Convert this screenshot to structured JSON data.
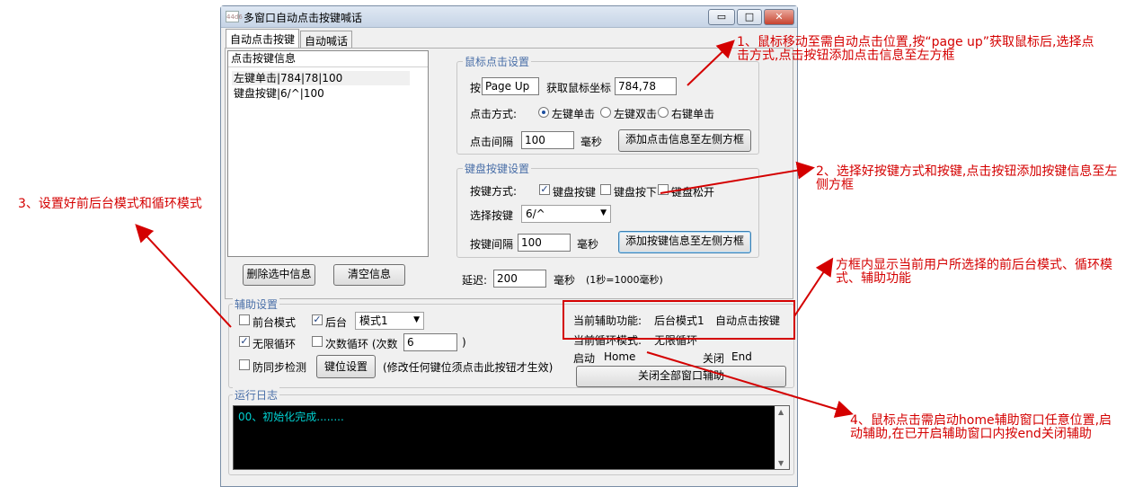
{
  "window": {
    "title": "多窗口自动点击按键喊话",
    "icon_text": "44d6",
    "controls": {
      "minimize": "▭",
      "maximize": "□",
      "close": "✕"
    }
  },
  "tabs": [
    {
      "label": "自动点击按键",
      "active": true
    },
    {
      "label": "自动喊话",
      "active": false
    }
  ],
  "key_list": {
    "header": "点击按键信息",
    "items": [
      "左键单击|784|78|100",
      "键盘按键|6/^|100"
    ]
  },
  "buttons": {
    "delete_selected": "删除选中信息",
    "clear_info": "清空信息",
    "add_click_info": "添加点击信息至左侧方框",
    "add_key_info": "添加按键信息至左侧方框",
    "key_settings": "键位设置",
    "close_all": "关闭全部窗口辅助"
  },
  "mouse_settings": {
    "legend": "鼠标点击设置",
    "press_label": "按",
    "hotkey_value": "Page Up",
    "get_coord_label": "获取鼠标坐标",
    "coord_value": "784,78",
    "method_label": "点击方式:",
    "methods": [
      "左键单击",
      "左键双击",
      "右键单击"
    ],
    "selected_method": "左键单击",
    "interval_label": "点击间隔",
    "interval_value": "100",
    "unit": "毫秒"
  },
  "keyboard_settings": {
    "legend": "键盘按键设置",
    "method_label": "按键方式:",
    "methods": [
      "键盘按键",
      "键盘按下",
      "键盘松开"
    ],
    "checked": [
      true,
      false,
      false
    ],
    "select_label": "选择按键",
    "selected_key": "6/^",
    "interval_label": "按键间隔",
    "interval_value": "100",
    "unit": "毫秒"
  },
  "delay": {
    "label": "延迟:",
    "value": "200",
    "unit": "毫秒",
    "note": "(1秒=1000毫秒)"
  },
  "aux_settings": {
    "legend": "辅助设置",
    "foreground_label": "前台模式",
    "foreground_checked": false,
    "background_label": "后台",
    "background_checked": true,
    "mode_value": "模式1",
    "infinite_loop_label": "无限循环",
    "infinite_loop_checked": true,
    "count_loop_label": "次数循环 (次数",
    "count_loop_checked": false,
    "count_value": "6",
    "count_close": ")",
    "sync_check_label": "防同步检测",
    "sync_check_checked": false,
    "key_settings_note": "(修改任何键位须点击此按钮才生效)"
  },
  "status": {
    "current_aux_label": "当前辅助功能:",
    "current_aux_value": "后台模式1",
    "current_aux_extra": "自动点击按键",
    "current_loop_label": "当前循环模式:",
    "current_loop_value": "无限循环",
    "start_label": "启动",
    "start_key": "Home",
    "stop_label": "关闭",
    "stop_key": "End"
  },
  "log": {
    "legend": "运行日志",
    "lines": [
      "00、初始化完成........"
    ]
  },
  "annotations": {
    "a1": "1、鼠标移动至需自动点击位置,按“page up”获取鼠标后,选择点击方式,点击按钮添加点击信息至左方框",
    "a2": "2、选择好按键方式和按键,点击按钮添加按键信息至左侧方框",
    "a3": "3、设置好前后台模式和循环模式",
    "a4_box": "方框内显示当前用户所选择的前后台模式、循环模式、辅助功能",
    "a5": "4、鼠标点击需启动home辅助窗口任意位置,启动辅助,在已开启辅助窗口内按end关闭辅助"
  },
  "colors": {
    "annotation": "#d40000",
    "legend": "#4a6fa8",
    "log_text": "#00d0d0"
  }
}
